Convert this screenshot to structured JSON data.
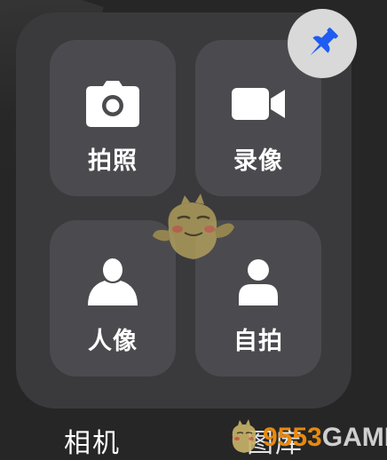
{
  "widget": {
    "pin_icon": "pushpin-icon",
    "pin_color": "#1e5cf2",
    "tiles": [
      {
        "label": "拍照",
        "icon": "camera-icon"
      },
      {
        "label": "录像",
        "icon": "video-camera-icon"
      },
      {
        "label": "人像",
        "icon": "person-icon"
      },
      {
        "label": "自拍",
        "icon": "selfie-person-icon"
      }
    ]
  },
  "apps": {
    "camera_label": "相机",
    "gallery_label": "图库"
  },
  "watermark": {
    "text_part1": "9553",
    "text_part2": "GAME"
  }
}
